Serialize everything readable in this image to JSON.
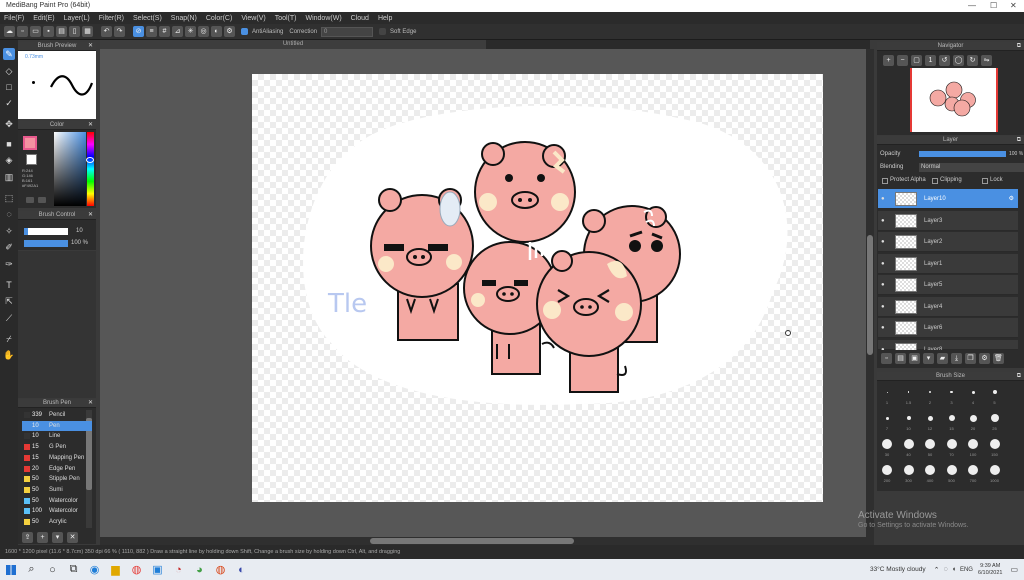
{
  "window": {
    "title": "MediBang Paint Pro (64bit)",
    "min": "—",
    "max": "☐",
    "close": "✕"
  },
  "menu": [
    "File(F)",
    "Edit(E)",
    "Layer(L)",
    "Filter(R)",
    "Select(S)",
    "Snap(N)",
    "Color(C)",
    "View(V)",
    "Tool(T)",
    "Window(W)",
    "Cloud",
    "Help"
  ],
  "toolbar": {
    "antialiasing": "AntiAliasing",
    "correction_label": "Correction",
    "correction_value": "0",
    "soft_edge": "Soft Edge"
  },
  "tab": {
    "title": "Untitled"
  },
  "brush_preview": {
    "title": "Brush Preview",
    "size": "0.73mm"
  },
  "color_panel": {
    "title": "Color",
    "r": "R:244",
    "g": "G:146",
    "b": "B:161",
    "hex": "#F492A1"
  },
  "brush_control": {
    "title": "Brush Control",
    "size": "10",
    "opacity": "100 %"
  },
  "brush_list": {
    "title": "Brush Pen",
    "items": [
      {
        "num": "339",
        "label": "Pencil",
        "color": "#333333"
      },
      {
        "num": "10",
        "label": "Pen",
        "color": "#4a90e2",
        "selected": true
      },
      {
        "num": "10",
        "label": "Line",
        "color": "#333333"
      },
      {
        "num": "15",
        "label": "G Pen",
        "color": "#e53935"
      },
      {
        "num": "15",
        "label": "Mapping Pen",
        "color": "#e53935"
      },
      {
        "num": "20",
        "label": "Edge Pen",
        "color": "#e53935"
      },
      {
        "num": "50",
        "label": "Stipple Pen",
        "color": "#f4d03f"
      },
      {
        "num": "50",
        "label": "Sumi",
        "color": "#f4d03f"
      },
      {
        "num": "50",
        "label": "Watercolor",
        "color": "#5bc0f8"
      },
      {
        "num": "100",
        "label": "Watercolor",
        "color": "#5bc0f8"
      },
      {
        "num": "50",
        "label": "Acrylic",
        "color": "#f4d03f"
      }
    ]
  },
  "navigator": {
    "title": "Navigator"
  },
  "layer_panel": {
    "title": "Layer",
    "opacity_label": "Opacity",
    "opacity_value": "100 %",
    "opacity_fraction": 1.0,
    "blending_label": "Blending",
    "blending_value": "Normal",
    "protect_alpha": "Protect Alpha",
    "clipping": "Clipping",
    "lock": "Lock",
    "layers": [
      "Layer10",
      "Layer3",
      "Layer2",
      "Layer1",
      "Layer5",
      "Layer4",
      "Layer6",
      "Layer8"
    ]
  },
  "brush_size": {
    "title": "Brush Size",
    "labels": [
      "1",
      "1.5",
      "2",
      "3",
      "4",
      "5",
      "7",
      "10",
      "12",
      "15",
      "20",
      "25",
      "30",
      "40",
      "50",
      "70",
      "100",
      "150",
      "200",
      "300",
      "400",
      "500",
      "700",
      "1000"
    ]
  },
  "canvas": {
    "text": "Tle"
  },
  "status": {
    "text": "1600 * 1200 pixel   (11.6 * 8.7cm)   350 dpi   66 %   ( 1110, 882 )   Draw a straight line by holding down Shift, Change a brush size by holding down Ctrl, Alt, and dragging"
  },
  "watermark": {
    "line1": "Activate Windows",
    "line2": "Go to Settings to activate Windows."
  },
  "taskbar": {
    "weather": "33°C  Mostly cloudy",
    "lang": "ENG",
    "time": "9:39 AM",
    "date": "6/10/2021"
  },
  "colors": {
    "accent": "#4a90e2",
    "pig": "#f4a9a3",
    "cheek": "#fbe8c8"
  }
}
